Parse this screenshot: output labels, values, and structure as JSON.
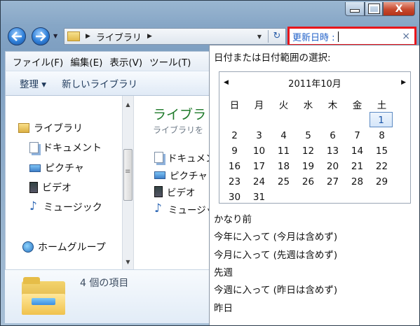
{
  "window": {
    "controls": {
      "minimize_icon": "minimize-icon",
      "maximize_icon": "maximize-icon",
      "close_glyph": "X"
    }
  },
  "navigation": {
    "address_breadcrumb": [
      "ライブラリ"
    ],
    "search_label": "更新日時 :",
    "search_clear_glyph": "×"
  },
  "menubar": {
    "items": [
      "ファイル(F)",
      "編集(E)",
      "表示(V)",
      "ツール(T)"
    ]
  },
  "commandbar": {
    "organize": "整理 ▾",
    "new_library": "新しいライブラリ"
  },
  "nav_tree": {
    "libraries": "ライブラリ",
    "documents": "ドキュメント",
    "pictures": "ピクチャ",
    "videos": "ビデオ",
    "music": "ミュージック",
    "homegroup": "ホームグループ"
  },
  "content": {
    "title": "ライブラリ",
    "subtitle": "ライブラリを",
    "items": [
      "ドキュメント",
      "ピクチャ",
      "ビデオ",
      "ミュージック"
    ]
  },
  "details": {
    "count_text": "4 個の項目"
  },
  "date_popup": {
    "header": "日付または日付範囲の選択:",
    "calendar": {
      "month_label": "2011年10月",
      "weekdays": [
        "日",
        "月",
        "火",
        "水",
        "木",
        "金",
        "土"
      ],
      "weeks": [
        [
          "",
          "",
          "",
          "",
          "",
          "",
          "1"
        ],
        [
          "2",
          "3",
          "4",
          "5",
          "6",
          "7",
          "8"
        ],
        [
          "9",
          "10",
          "11",
          "12",
          "13",
          "14",
          "15"
        ],
        [
          "16",
          "17",
          "18",
          "19",
          "20",
          "21",
          "22"
        ],
        [
          "23",
          "24",
          "25",
          "26",
          "27",
          "28",
          "29"
        ],
        [
          "30",
          "31",
          "",
          "",
          "",
          "",
          ""
        ]
      ],
      "today": "1"
    },
    "presets": [
      "かなり前",
      "今年に入って (今月は含めず)",
      "今月に入って (先週は含めず)",
      "先週",
      "今週に入って (昨日は含めず)",
      "昨日"
    ]
  },
  "colors": {
    "search_highlight": "#e8151b",
    "library_title": "#1e7a2a",
    "link_blue": "#2262c9"
  }
}
